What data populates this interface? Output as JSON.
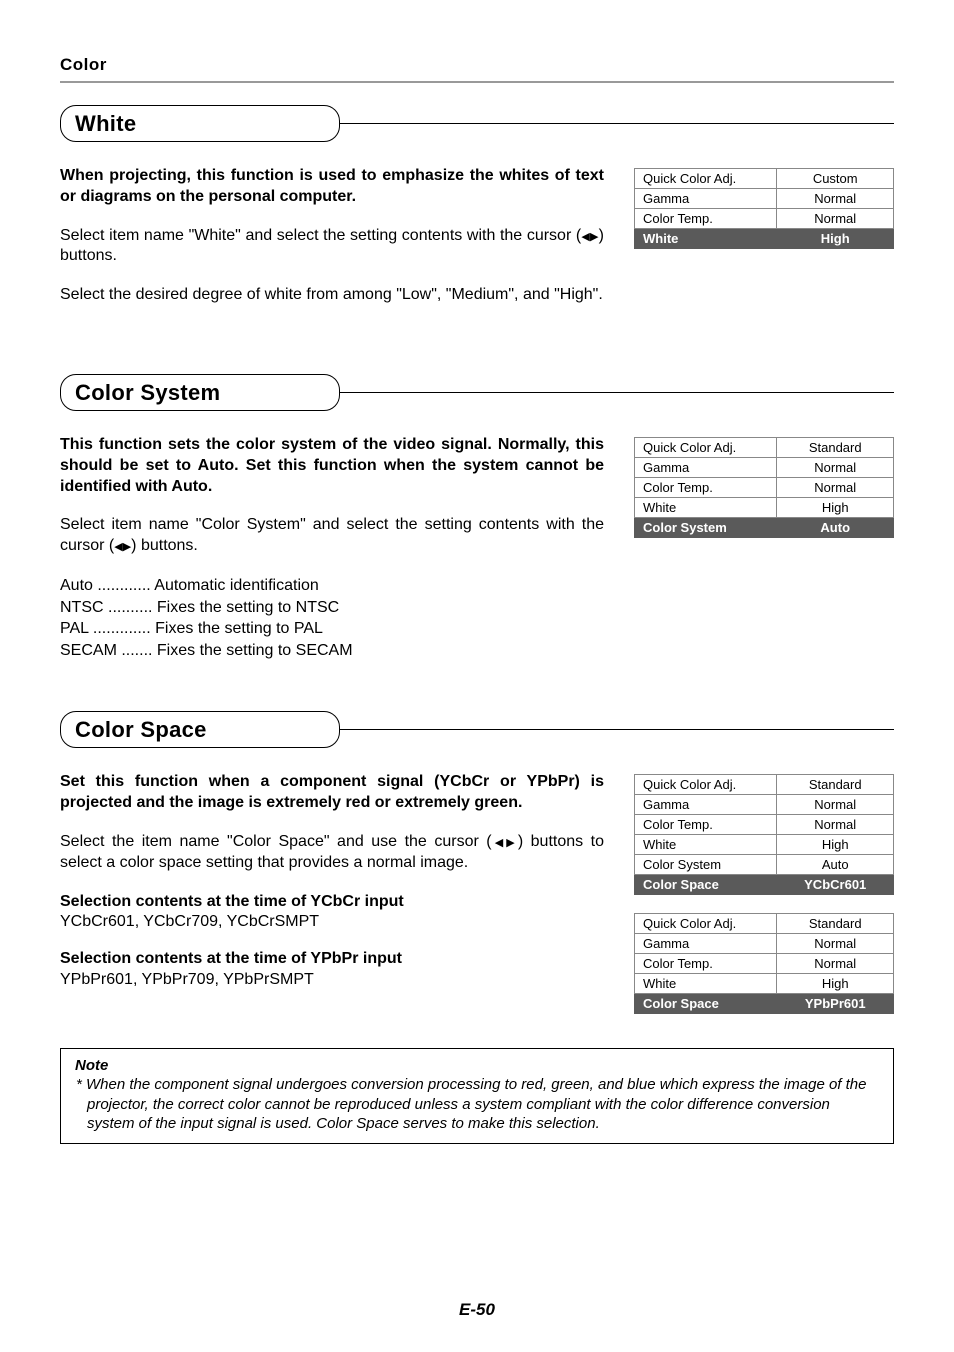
{
  "page": {
    "section_title": "Color",
    "page_number": "E-50"
  },
  "white": {
    "heading": "White",
    "intro": "When projecting, this function is used to emphasize the whites of text or diagrams on the personal computer.",
    "para1_a": "Select item name \"White\" and select the setting contents with the cursor (",
    "para1_b": ") buttons.",
    "para2": "Select the desired degree of white from among \"Low\", \"Medium\", and \"High\".",
    "menu": [
      {
        "label": "Quick Color Adj.",
        "value": "Custom"
      },
      {
        "label": "Gamma",
        "value": "Normal"
      },
      {
        "label": "Color Temp.",
        "value": "Normal"
      },
      {
        "label": "White",
        "value": "High",
        "highlight": true
      }
    ]
  },
  "color_system": {
    "heading": "Color System",
    "intro": "This function sets the color system of the video signal. Normally, this should be set to Auto. Set this function when the system cannot be identified with Auto.",
    "para1_a": "Select item name \"Color System\" and select the setting contents with the cursor (",
    "para1_b": ") buttons.",
    "defs": [
      "Auto ............ Automatic identification",
      "NTSC .......... Fixes the setting to NTSC",
      "PAL ............. Fixes the setting to PAL",
      "SECAM ....... Fixes the setting to SECAM"
    ],
    "menu": [
      {
        "label": "Quick Color Adj.",
        "value": "Standard"
      },
      {
        "label": "Gamma",
        "value": "Normal"
      },
      {
        "label": "Color Temp.",
        "value": "Normal"
      },
      {
        "label": "White",
        "value": "High"
      },
      {
        "label": "Color System",
        "value": "Auto",
        "highlight": true
      }
    ]
  },
  "color_space": {
    "heading": "Color Space",
    "intro": "Set this function when a component signal (YCbCr or YPbPr) is projected and the image is extremely red or extremely green.",
    "para1_a": "Select the item name \"Color Space\" and use the cursor (",
    "para1_b": ") buttons to select a color space setting that provides a normal image.",
    "sel1_title": "Selection contents at the time of YCbCr input",
    "sel1_body": "YCbCr601, YCbCr709, YCbCrSMPT",
    "sel2_title": "Selection contents at the time of YPbPr input",
    "sel2_body": "YPbPr601, YPbPr709, YPbPrSMPT",
    "menu1": [
      {
        "label": "Quick Color Adj.",
        "value": "Standard"
      },
      {
        "label": "Gamma",
        "value": "Normal"
      },
      {
        "label": "Color Temp.",
        "value": "Normal"
      },
      {
        "label": "White",
        "value": "High"
      },
      {
        "label": "Color System",
        "value": "Auto"
      },
      {
        "label": "Color Space",
        "value": "YCbCr601",
        "highlight": true
      }
    ],
    "menu2": [
      {
        "label": "Quick Color Adj.",
        "value": "Standard"
      },
      {
        "label": "Gamma",
        "value": "Normal"
      },
      {
        "label": "Color Temp.",
        "value": "Normal"
      },
      {
        "label": "White",
        "value": "High"
      },
      {
        "label": "Color Space",
        "value": "YPbPr601",
        "highlight": true
      }
    ]
  },
  "note": {
    "title": "Note",
    "body": "* When the component signal undergoes conversion processing to red, green, and blue which express the image of the projector, the correct color cannot be reproduced unless a system compliant with the color difference conversion system of the input signal is used. Color Space serves to make this selection."
  }
}
